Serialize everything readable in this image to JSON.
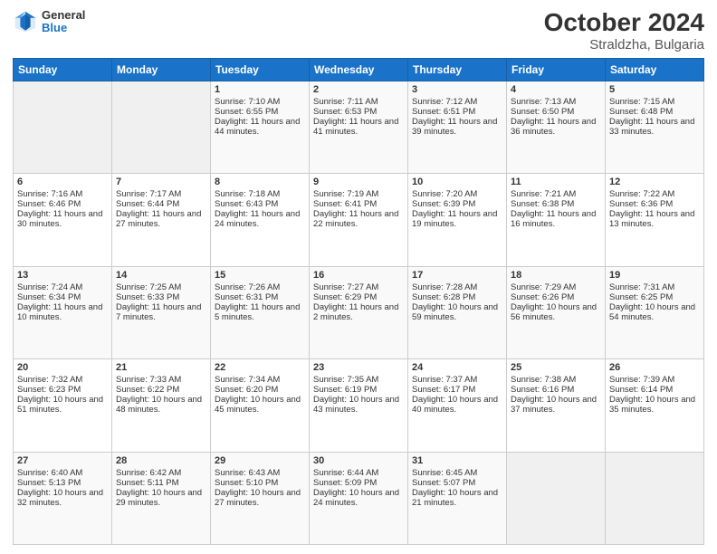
{
  "header": {
    "logo_general": "General",
    "logo_blue": "Blue",
    "title": "October 2024",
    "subtitle": "Straldzha, Bulgaria"
  },
  "days_of_week": [
    "Sunday",
    "Monday",
    "Tuesday",
    "Wednesday",
    "Thursday",
    "Friday",
    "Saturday"
  ],
  "weeks": [
    [
      {
        "day": "",
        "empty": true
      },
      {
        "day": "",
        "empty": true
      },
      {
        "day": "1",
        "sunrise": "Sunrise: 7:10 AM",
        "sunset": "Sunset: 6:55 PM",
        "daylight": "Daylight: 11 hours and 44 minutes."
      },
      {
        "day": "2",
        "sunrise": "Sunrise: 7:11 AM",
        "sunset": "Sunset: 6:53 PM",
        "daylight": "Daylight: 11 hours and 41 minutes."
      },
      {
        "day": "3",
        "sunrise": "Sunrise: 7:12 AM",
        "sunset": "Sunset: 6:51 PM",
        "daylight": "Daylight: 11 hours and 39 minutes."
      },
      {
        "day": "4",
        "sunrise": "Sunrise: 7:13 AM",
        "sunset": "Sunset: 6:50 PM",
        "daylight": "Daylight: 11 hours and 36 minutes."
      },
      {
        "day": "5",
        "sunrise": "Sunrise: 7:15 AM",
        "sunset": "Sunset: 6:48 PM",
        "daylight": "Daylight: 11 hours and 33 minutes."
      }
    ],
    [
      {
        "day": "6",
        "sunrise": "Sunrise: 7:16 AM",
        "sunset": "Sunset: 6:46 PM",
        "daylight": "Daylight: 11 hours and 30 minutes."
      },
      {
        "day": "7",
        "sunrise": "Sunrise: 7:17 AM",
        "sunset": "Sunset: 6:44 PM",
        "daylight": "Daylight: 11 hours and 27 minutes."
      },
      {
        "day": "8",
        "sunrise": "Sunrise: 7:18 AM",
        "sunset": "Sunset: 6:43 PM",
        "daylight": "Daylight: 11 hours and 24 minutes."
      },
      {
        "day": "9",
        "sunrise": "Sunrise: 7:19 AM",
        "sunset": "Sunset: 6:41 PM",
        "daylight": "Daylight: 11 hours and 22 minutes."
      },
      {
        "day": "10",
        "sunrise": "Sunrise: 7:20 AM",
        "sunset": "Sunset: 6:39 PM",
        "daylight": "Daylight: 11 hours and 19 minutes."
      },
      {
        "day": "11",
        "sunrise": "Sunrise: 7:21 AM",
        "sunset": "Sunset: 6:38 PM",
        "daylight": "Daylight: 11 hours and 16 minutes."
      },
      {
        "day": "12",
        "sunrise": "Sunrise: 7:22 AM",
        "sunset": "Sunset: 6:36 PM",
        "daylight": "Daylight: 11 hours and 13 minutes."
      }
    ],
    [
      {
        "day": "13",
        "sunrise": "Sunrise: 7:24 AM",
        "sunset": "Sunset: 6:34 PM",
        "daylight": "Daylight: 11 hours and 10 minutes."
      },
      {
        "day": "14",
        "sunrise": "Sunrise: 7:25 AM",
        "sunset": "Sunset: 6:33 PM",
        "daylight": "Daylight: 11 hours and 7 minutes."
      },
      {
        "day": "15",
        "sunrise": "Sunrise: 7:26 AM",
        "sunset": "Sunset: 6:31 PM",
        "daylight": "Daylight: 11 hours and 5 minutes."
      },
      {
        "day": "16",
        "sunrise": "Sunrise: 7:27 AM",
        "sunset": "Sunset: 6:29 PM",
        "daylight": "Daylight: 11 hours and 2 minutes."
      },
      {
        "day": "17",
        "sunrise": "Sunrise: 7:28 AM",
        "sunset": "Sunset: 6:28 PM",
        "daylight": "Daylight: 10 hours and 59 minutes."
      },
      {
        "day": "18",
        "sunrise": "Sunrise: 7:29 AM",
        "sunset": "Sunset: 6:26 PM",
        "daylight": "Daylight: 10 hours and 56 minutes."
      },
      {
        "day": "19",
        "sunrise": "Sunrise: 7:31 AM",
        "sunset": "Sunset: 6:25 PM",
        "daylight": "Daylight: 10 hours and 54 minutes."
      }
    ],
    [
      {
        "day": "20",
        "sunrise": "Sunrise: 7:32 AM",
        "sunset": "Sunset: 6:23 PM",
        "daylight": "Daylight: 10 hours and 51 minutes."
      },
      {
        "day": "21",
        "sunrise": "Sunrise: 7:33 AM",
        "sunset": "Sunset: 6:22 PM",
        "daylight": "Daylight: 10 hours and 48 minutes."
      },
      {
        "day": "22",
        "sunrise": "Sunrise: 7:34 AM",
        "sunset": "Sunset: 6:20 PM",
        "daylight": "Daylight: 10 hours and 45 minutes."
      },
      {
        "day": "23",
        "sunrise": "Sunrise: 7:35 AM",
        "sunset": "Sunset: 6:19 PM",
        "daylight": "Daylight: 10 hours and 43 minutes."
      },
      {
        "day": "24",
        "sunrise": "Sunrise: 7:37 AM",
        "sunset": "Sunset: 6:17 PM",
        "daylight": "Daylight: 10 hours and 40 minutes."
      },
      {
        "day": "25",
        "sunrise": "Sunrise: 7:38 AM",
        "sunset": "Sunset: 6:16 PM",
        "daylight": "Daylight: 10 hours and 37 minutes."
      },
      {
        "day": "26",
        "sunrise": "Sunrise: 7:39 AM",
        "sunset": "Sunset: 6:14 PM",
        "daylight": "Daylight: 10 hours and 35 minutes."
      }
    ],
    [
      {
        "day": "27",
        "sunrise": "Sunrise: 6:40 AM",
        "sunset": "Sunset: 5:13 PM",
        "daylight": "Daylight: 10 hours and 32 minutes."
      },
      {
        "day": "28",
        "sunrise": "Sunrise: 6:42 AM",
        "sunset": "Sunset: 5:11 PM",
        "daylight": "Daylight: 10 hours and 29 minutes."
      },
      {
        "day": "29",
        "sunrise": "Sunrise: 6:43 AM",
        "sunset": "Sunset: 5:10 PM",
        "daylight": "Daylight: 10 hours and 27 minutes."
      },
      {
        "day": "30",
        "sunrise": "Sunrise: 6:44 AM",
        "sunset": "Sunset: 5:09 PM",
        "daylight": "Daylight: 10 hours and 24 minutes."
      },
      {
        "day": "31",
        "sunrise": "Sunrise: 6:45 AM",
        "sunset": "Sunset: 5:07 PM",
        "daylight": "Daylight: 10 hours and 21 minutes."
      },
      {
        "day": "",
        "empty": true
      },
      {
        "day": "",
        "empty": true
      }
    ]
  ]
}
